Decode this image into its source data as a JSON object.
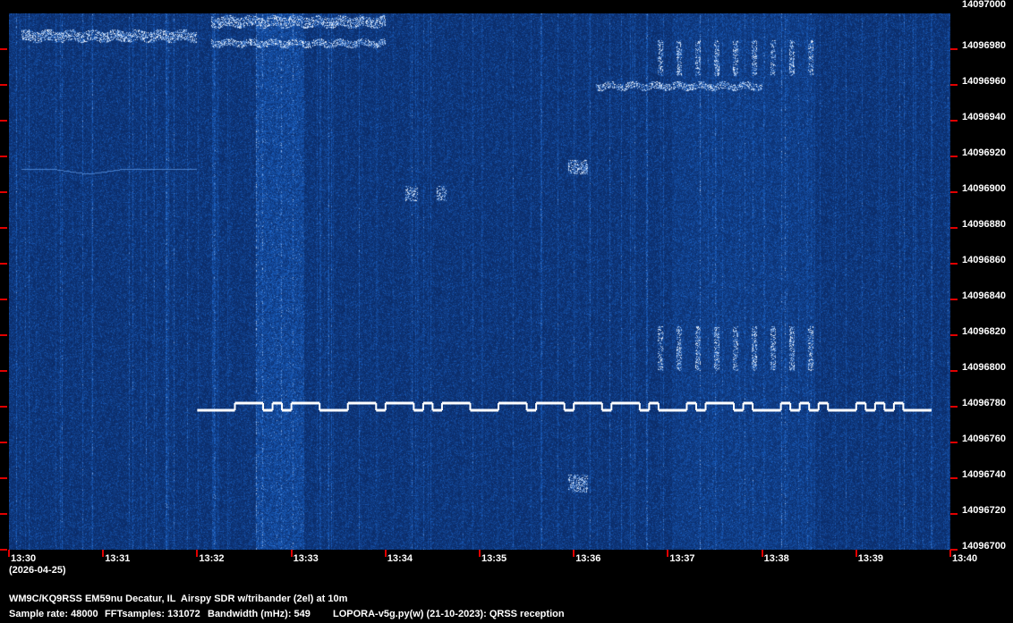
{
  "chart_data": {
    "type": "heatmap",
    "title": "QRSS spectrogram",
    "x_ticks": [
      "13:30",
      "13:31",
      "13:32",
      "13:33",
      "13:34",
      "13:35",
      "13:36",
      "13:37",
      "13:38",
      "13:39",
      "13:40"
    ],
    "date_label": "(2026-04-25)",
    "y_ticks": [
      "14097000",
      "14096980",
      "14096960",
      "14096940",
      "14096920",
      "14096900",
      "14096880",
      "14096860",
      "14096840",
      "14096820",
      "14096800",
      "14096780",
      "14096760",
      "14096740",
      "14096720",
      "14096700"
    ],
    "xlim_minutes_after_1330": [
      0,
      10
    ],
    "ylim_hz": [
      14096700,
      14097000
    ],
    "colors": {
      "background": "#000000",
      "waterfall_low": "#061a4a",
      "waterfall_high": "#ffffff",
      "tick": "#e00000"
    },
    "fsk_trace": {
      "start_min": 2.0,
      "unit_min": 0.1,
      "low_hz": 14096778,
      "high_hz": 14096782,
      "first_level": "low",
      "durations_units": [
        4,
        3,
        1,
        1,
        1,
        3,
        3,
        3,
        1,
        3,
        1,
        1,
        1,
        3,
        3,
        3,
        1,
        3,
        1,
        3,
        1,
        3,
        1,
        1,
        3,
        1,
        1,
        3,
        1,
        1,
        3,
        1,
        1,
        1,
        1,
        1,
        3,
        1,
        1,
        1,
        1,
        1,
        3
      ]
    },
    "features": [
      {
        "t": [
          0.14,
          2.0
        ],
        "f": [
          14096984,
          14096990
        ],
        "kind": "band"
      },
      {
        "t": [
          2.15,
          4.0
        ],
        "f": [
          14096992,
          14096998
        ],
        "kind": "band"
      },
      {
        "t": [
          2.15,
          4.0
        ],
        "f": [
          14096981,
          14096985
        ],
        "kind": "band"
      },
      {
        "t": [
          6.24,
          8.0
        ],
        "f": [
          14096957,
          14096961
        ],
        "kind": "band"
      },
      {
        "t": [
          6.9,
          8.55
        ],
        "f": [
          14096965,
          14096985
        ],
        "kind": "stripes"
      },
      {
        "t": [
          6.9,
          8.55
        ],
        "f": [
          14096800,
          14096825
        ],
        "kind": "stripes"
      },
      {
        "t": [
          5.95,
          6.15
        ],
        "f": [
          14096910,
          14096918
        ],
        "kind": "dots"
      },
      {
        "t": [
          5.95,
          6.15
        ],
        "f": [
          14096732,
          14096742
        ],
        "kind": "dots"
      },
      {
        "t": [
          4.22,
          4.35
        ],
        "f": [
          14096895,
          14096903
        ],
        "kind": "dots"
      },
      {
        "t": [
          4.55,
          4.65
        ],
        "f": [
          14096895,
          14096903
        ],
        "kind": "dots"
      }
    ],
    "carrier_line": {
      "t": [
        0.14,
        2.0
      ],
      "hz": 14096913,
      "dip_t": 0.85,
      "dip_hz": 14096910
    }
  },
  "footer": {
    "station": "WM9C/KQ9RSS EM59nu Decatur, IL  Airspy SDR w/tribander (2el) at 10m",
    "sample_rate": "Sample rate: 48000",
    "fft": "FFTsamples: 131072",
    "bandwidth": "Bandwidth (mHz): 549",
    "software": "LOPORA-v5g.py(w) (21-10-2023): QRSS reception"
  }
}
